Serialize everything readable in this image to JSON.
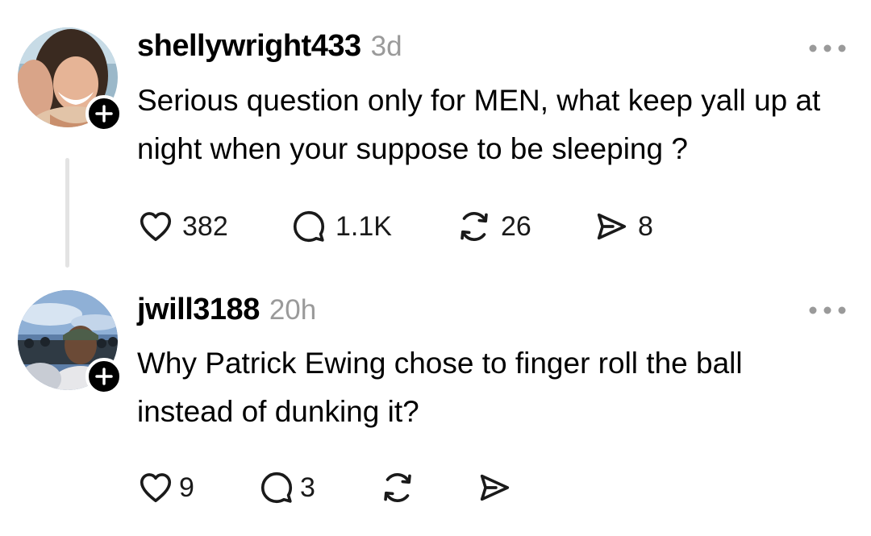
{
  "posts": [
    {
      "username": "shellywright433",
      "time": "3d",
      "text": "Serious question only for MEN, what keep yall up at night when your suppose to be sleeping ?",
      "likes": "382",
      "replies": "1.1K",
      "reposts": "26",
      "shares": "8"
    },
    {
      "username": "jwill3188",
      "time": "20h",
      "text": "Why Patrick Ewing chose to finger roll the ball instead of dunking it?",
      "likes": "9",
      "replies": "3",
      "reposts": "",
      "shares": ""
    }
  ],
  "icons": {
    "like": "heart-icon",
    "reply": "speech-bubble-icon",
    "repost": "repost-arrows-icon",
    "share": "paper-plane-icon",
    "more": "ellipsis-icon",
    "follow": "plus-icon"
  },
  "colors": {
    "text": "#000000",
    "secondary_text": "#9a9a9a",
    "icon": "#1a1a1a",
    "thread_line": "#e3e3e3",
    "follow_badge": "#000000"
  }
}
